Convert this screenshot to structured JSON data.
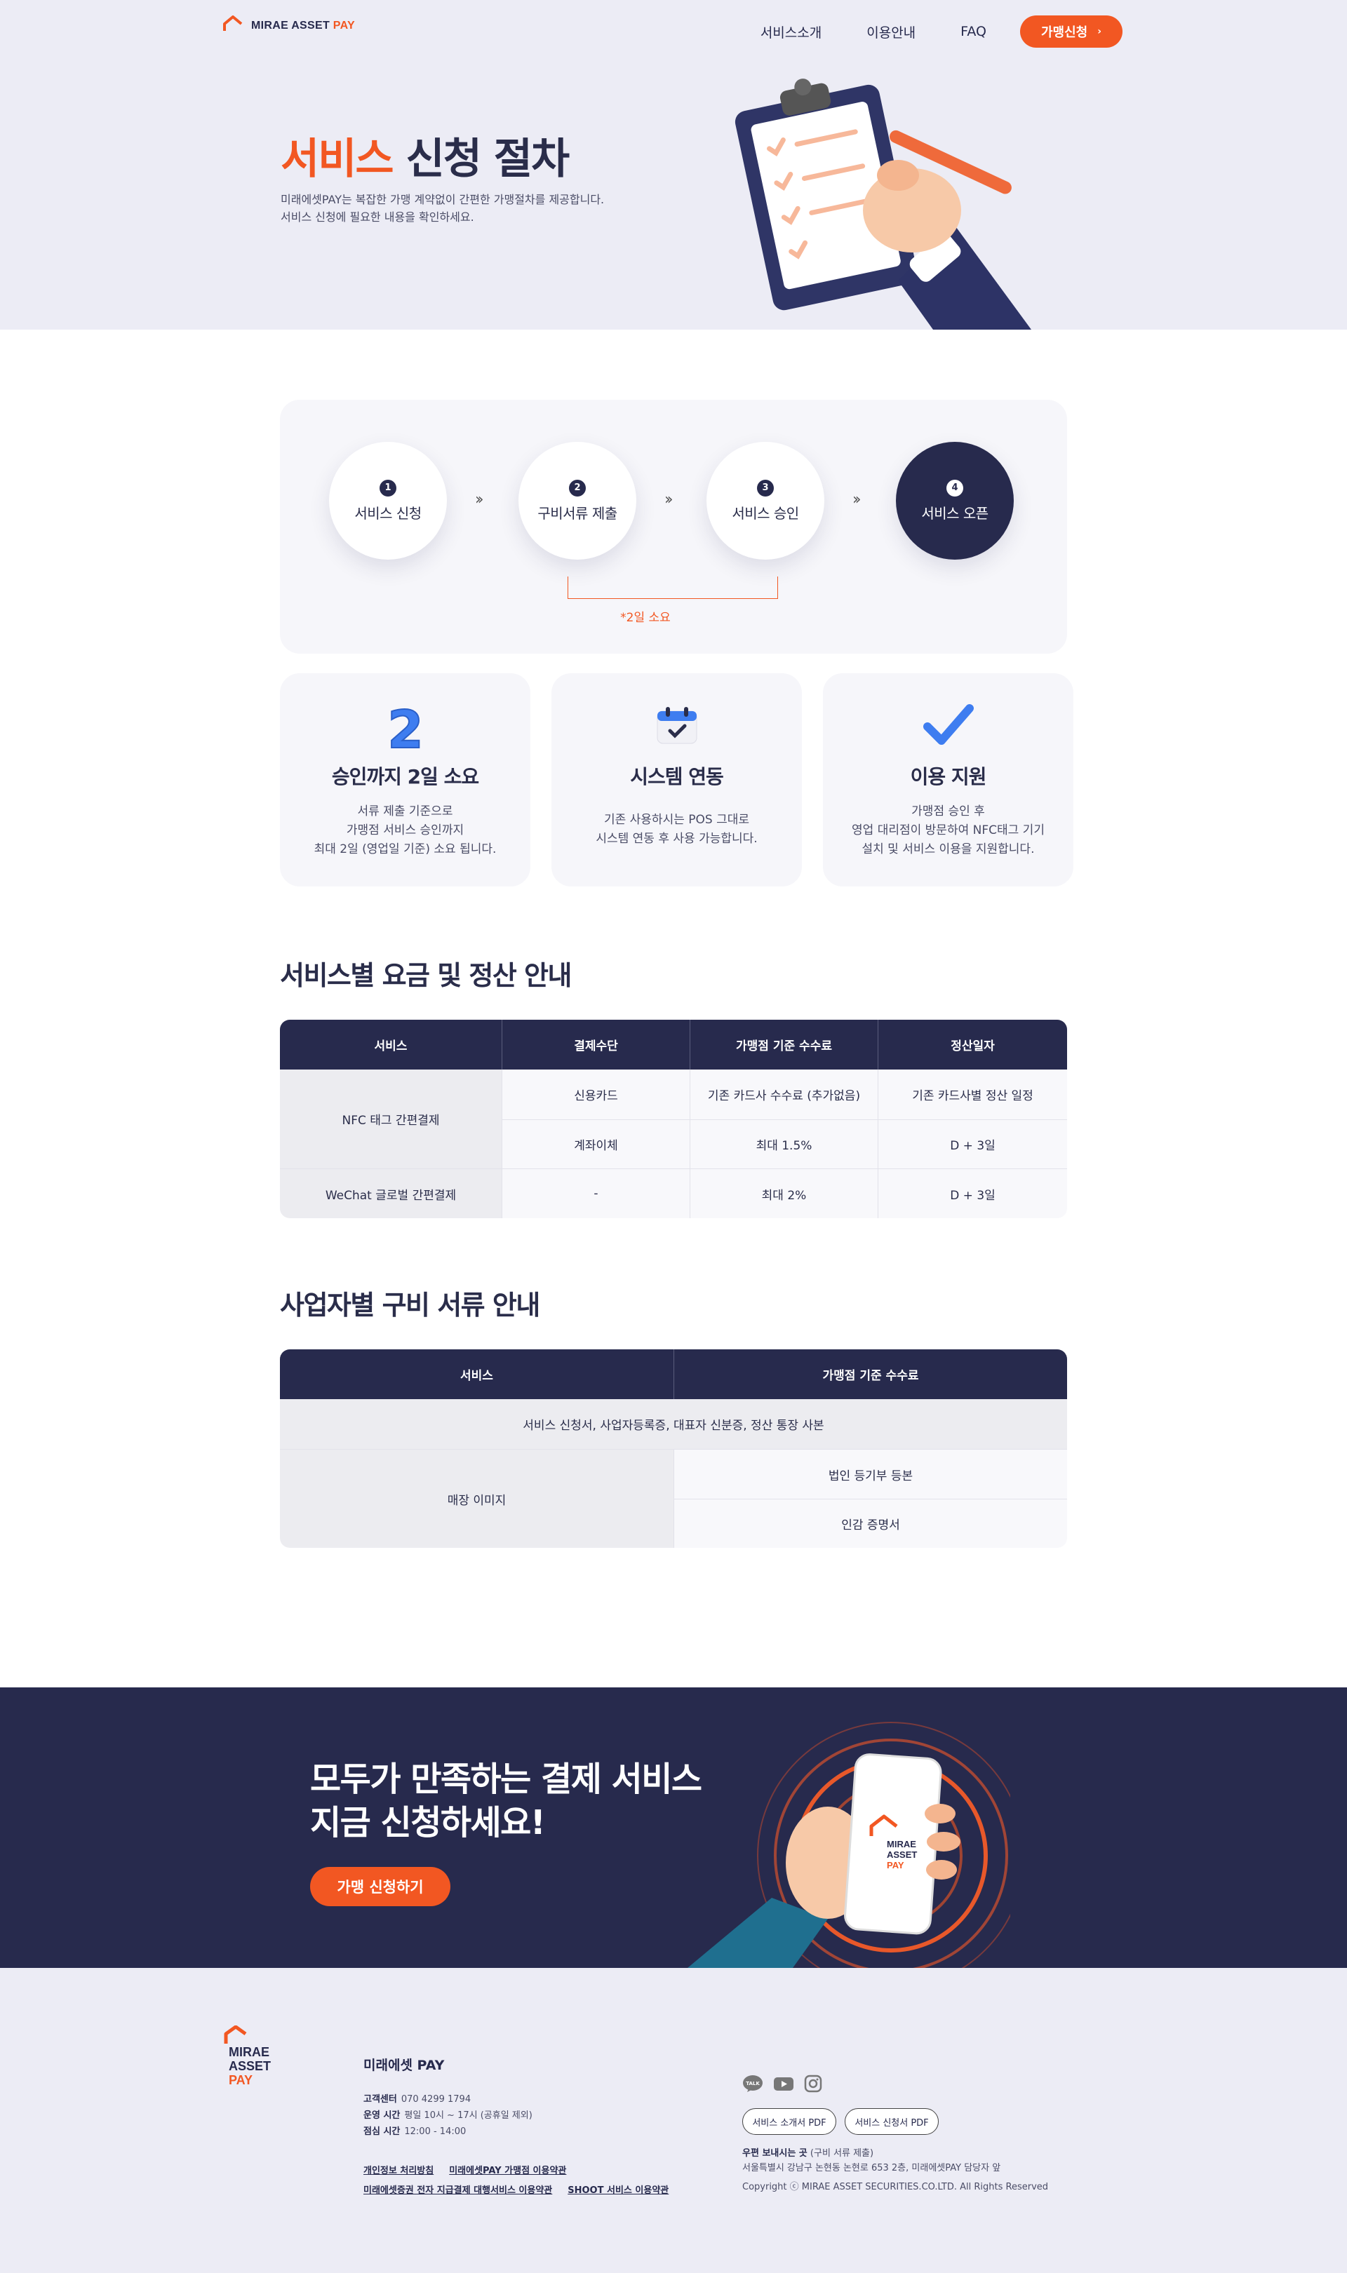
{
  "header": {
    "logo_text_main": "MIRAE ASSET ",
    "logo_text_pay": "PAY",
    "nav": [
      "서비스소개",
      "이용안내",
      "FAQ"
    ],
    "cta_label": "가맹신청",
    "cta_chevron": "›"
  },
  "hero": {
    "title_accent": "서비스",
    "title_rest": " 신청 절차",
    "desc_line1": "미래에셋PAY는 복잡한 가맹 계약없이 간편한 가맹절차를 제공합니다.",
    "desc_line2": "서비스 신청에 필요한 내용을 확인하세요."
  },
  "process": {
    "steps": [
      {
        "num": "1",
        "label": "서비스 신청"
      },
      {
        "num": "2",
        "label": "구비서류 제출"
      },
      {
        "num": "3",
        "label": "서비스 승인"
      },
      {
        "num": "4",
        "label": "서비스 오픈"
      }
    ],
    "arrow": "››",
    "note": "*2일 소요"
  },
  "features": [
    {
      "icon": "number-2-icon",
      "title": "승인까지 2일 소요",
      "lines": [
        "서류 제출 기준으로",
        "가맹점 서비스 승인까지",
        "최대 2일 (영업일 기준) 소요 됩니다."
      ]
    },
    {
      "icon": "calendar-check-icon",
      "title": "시스템 연동",
      "lines": [
        "기존 사용하시는 POS 그대로",
        "시스템 연동 후 사용 가능합니다."
      ]
    },
    {
      "icon": "checkmark-icon",
      "title": "이용 지원",
      "lines": [
        "가맹점 승인 후",
        "영업 대리점이 방문하여 NFC태그 기기",
        "설치 및 서비스 이용을 지원합니다."
      ]
    }
  ],
  "fee_section": {
    "title": "서비스별 요금 및 정산 안내",
    "headers": [
      "서비스",
      "결제수단",
      "가맹점 기준 수수료",
      "정산일자"
    ],
    "nfc_service": "NFC 태그 간편결제",
    "nfc_rows": [
      [
        "신용카드",
        "기존 카드사 수수료 (추가없음)",
        "기존 카드사별 정산 일정"
      ],
      [
        "계좌이체",
        "최대 1.5%",
        "D + 3일"
      ]
    ],
    "wechat_row": [
      "WeChat 글로벌 간편결제",
      "-",
      "최대 2%",
      "D + 3일"
    ]
  },
  "docs_section": {
    "title": "사업자별 구비 서류 안내",
    "headers": [
      "서비스",
      "가맹점 기준 수수료"
    ],
    "common_row": "서비스 신청서, 사업자등록증, 대표자 신분증, 정산 통장 사본",
    "store_label": "매장 이미지",
    "store_items": [
      "법인 등기부 등본",
      "인감 증명서"
    ]
  },
  "banner": {
    "title_line1": "모두가 만족하는 결제 서비스",
    "title_line2": "지금 신청하세요!",
    "button": "가맹 신청하기",
    "phone_logo": [
      "MIRAE",
      "ASSET",
      "PAY"
    ]
  },
  "footer": {
    "logo_lines": [
      "MIRAE",
      "ASSET",
      "PAY"
    ],
    "brand": "미래에셋 PAY",
    "cs_label": "고객센터",
    "cs_value": "070 4299 1794",
    "hours_label": "운영 시간",
    "hours_value": "평일 10시 ~ 17시 (공휴일 제외)",
    "lunch_label": "점심 시간",
    "lunch_value": "12:00 - 14:00",
    "links_row1": [
      "개인정보 처리방침",
      "미래에셋PAY 가맹점 이용약관"
    ],
    "links_row2": [
      "미래에셋증권 전자 지급결제 대행서비스 이용약관",
      "SHOOT 서비스 이용약관"
    ],
    "social": [
      "kakaotalk-icon",
      "youtube-icon",
      "instagram-icon"
    ],
    "pdf_buttons": [
      "서비스 소개서 PDF",
      "서비스 신청서 PDF"
    ],
    "addr_label": "우편 보내시는 곳",
    "addr_note": " (구비 서류 제출)",
    "addr_line": "서울특별시 강남구 논현동 논현로 653 2층, 미래에셋PAY 담당자 앞",
    "copyright": "Copyright ⓒ MIRAE ASSET SECURITIES.CO.LTD.    All Rights Reserved"
  },
  "colors": {
    "accent": "#f25722",
    "navy": "#272a4d",
    "hero_bg": "#ececf5"
  }
}
